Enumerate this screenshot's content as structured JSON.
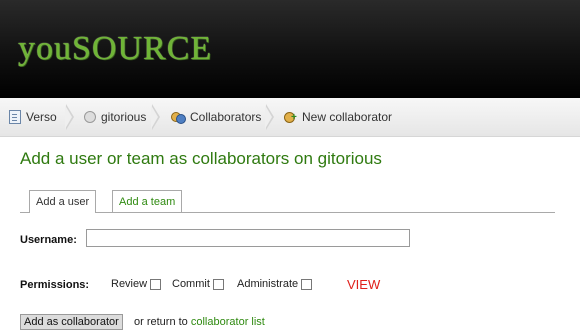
{
  "header": {
    "logo": "youSOURCE"
  },
  "breadcrumb": {
    "items": [
      {
        "label": "Verso",
        "icon": "document-icon"
      },
      {
        "label": "gitorious",
        "icon": "repository-icon"
      },
      {
        "label": "Collaborators",
        "icon": "users-icon"
      },
      {
        "label": "New collaborator",
        "icon": "add-user-icon"
      }
    ]
  },
  "page": {
    "title": "Add a user or team as collaborators on gitorious"
  },
  "tabs": {
    "user": "Add a user",
    "team": "Add a team"
  },
  "form": {
    "username_label": "Username",
    "username_value": "",
    "permissions_label": "Permissions",
    "review": "Review",
    "commit": "Commit",
    "administrate": "Administrate",
    "view": "VIEW"
  },
  "actions": {
    "submit": "Add as collaborator",
    "or_return": "or return to",
    "collab_list": "collaborator list"
  }
}
